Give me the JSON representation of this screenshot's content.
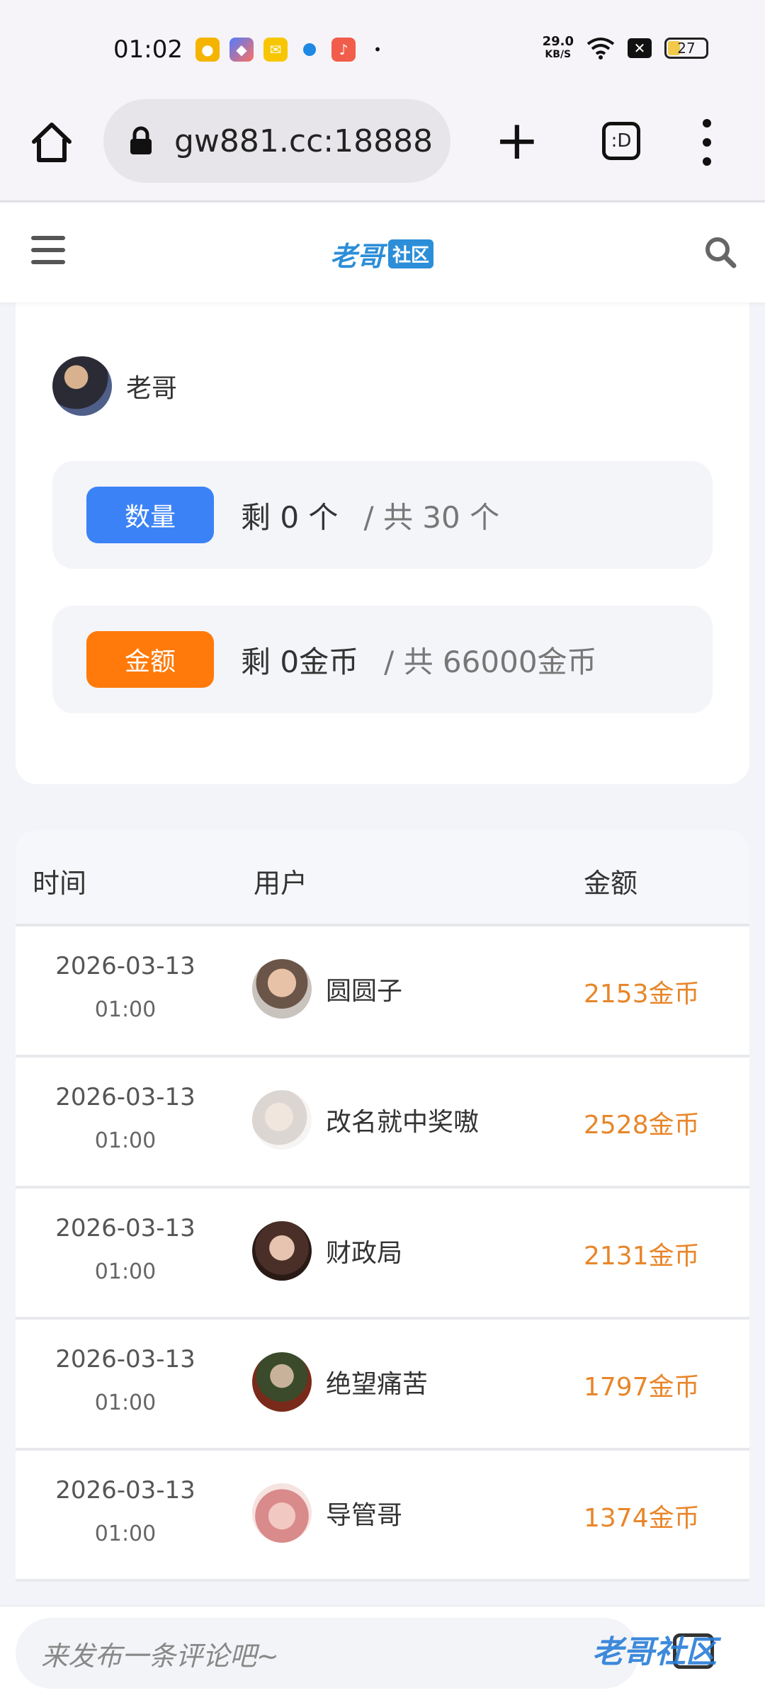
{
  "status_bar": {
    "time": "01:02",
    "net_speed_value": "29.0",
    "net_speed_unit": "KB/S",
    "battery": "27",
    "apps": [
      "weibo-icon",
      "shortcut-icon",
      "mail-icon",
      "browser-icon",
      "music-icon",
      "dot-icon"
    ]
  },
  "browser": {
    "url": "gw881.cc:18888",
    "tabs_label": ":D"
  },
  "header": {
    "logo_main": "老哥",
    "logo_sub": "社区"
  },
  "card": {
    "author_name": "老哥",
    "quantity": {
      "badge": "数量",
      "remaining": "剩 0 个",
      "total": "/ 共 30 个"
    },
    "amount": {
      "badge": "金额",
      "remaining": "剩 0金币",
      "total": "/ 共 66000金币"
    }
  },
  "table": {
    "headers": {
      "time": "时间",
      "user": "用户",
      "amount": "金额"
    },
    "rows": [
      {
        "date": "2026-03-13",
        "time": "01:00",
        "user": "圆圆子",
        "amount": "2153金币"
      },
      {
        "date": "2026-03-13",
        "time": "01:00",
        "user": "改名就中奖嗷",
        "amount": "2528金币"
      },
      {
        "date": "2026-03-13",
        "time": "01:00",
        "user": "财政局",
        "amount": "2131金币"
      },
      {
        "date": "2026-03-13",
        "time": "01:00",
        "user": "绝望痛苦",
        "amount": "1797金币"
      },
      {
        "date": "2026-03-13",
        "time": "01:00",
        "user": "导管哥",
        "amount": "1374金币"
      }
    ]
  },
  "comment": {
    "placeholder": "来发布一条评论吧~"
  },
  "watermark": "老哥社区",
  "colors": {
    "accent_blue": "#3b82f6",
    "accent_orange": "#ff7a0a",
    "amount_text": "#e8862a"
  }
}
